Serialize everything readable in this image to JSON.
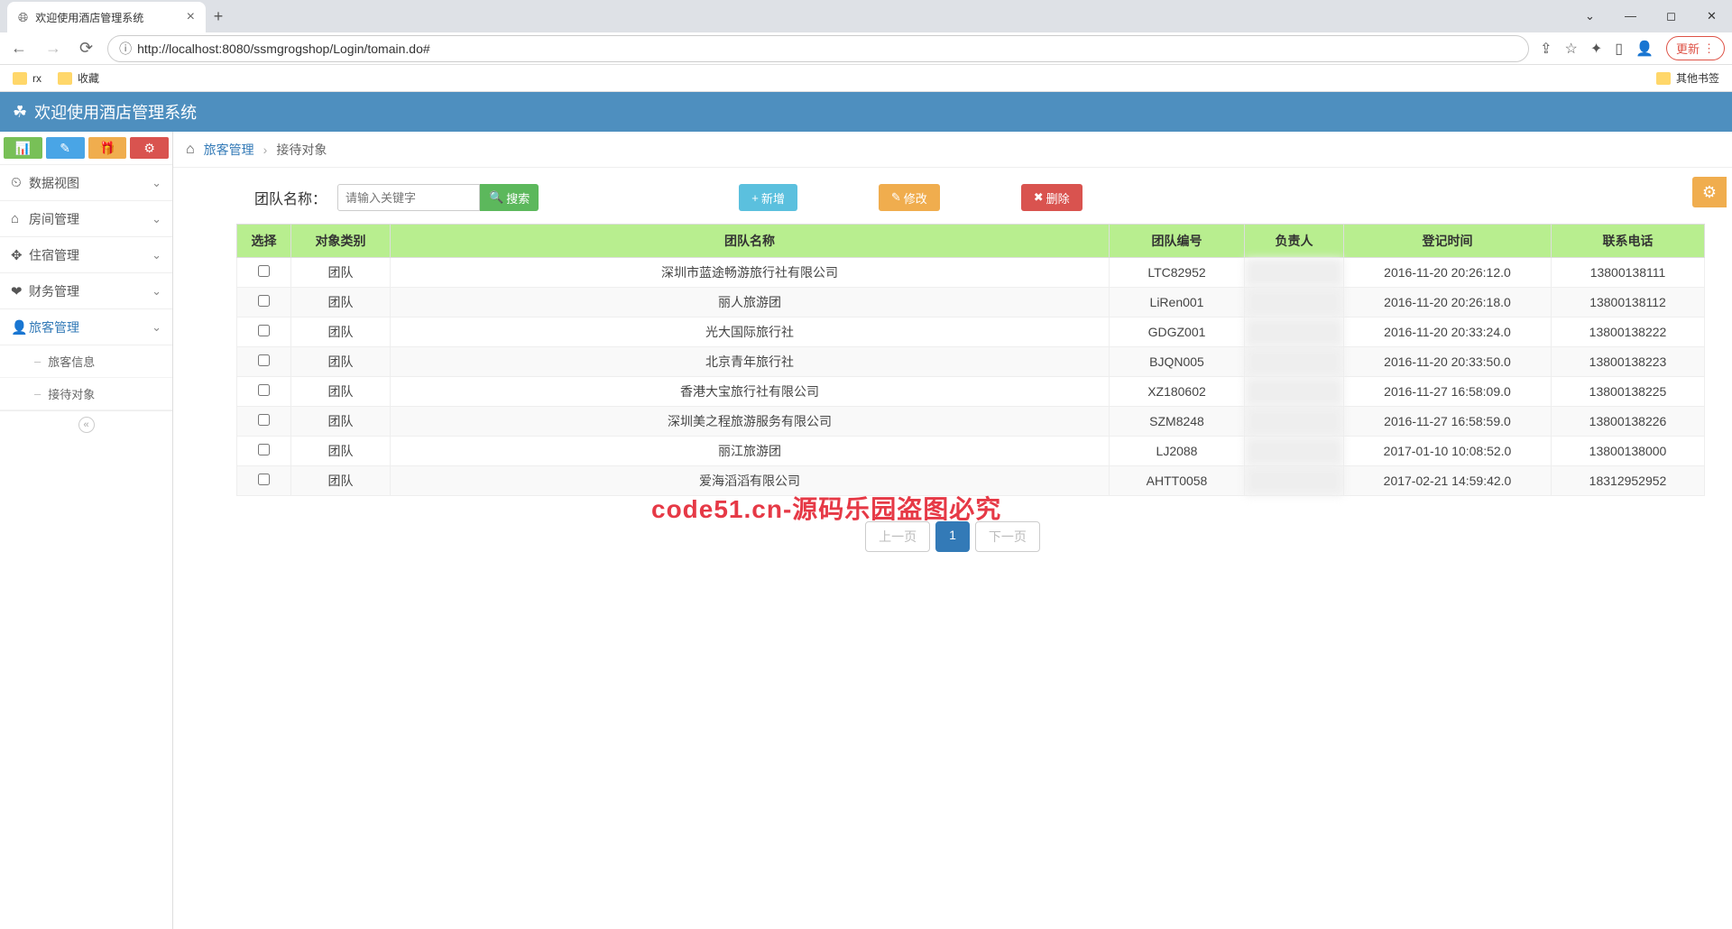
{
  "browser": {
    "tab_title": "欢迎使用酒店管理系统",
    "url": "http://localhost:8080/ssmgrogshop/Login/tomain.do#",
    "update_label": "更新",
    "bookmarks": [
      "rx",
      "收藏"
    ],
    "other_bookmarks": "其他书签"
  },
  "app": {
    "title": "欢迎使用酒店管理系统"
  },
  "sidebar": {
    "items": [
      {
        "icon": "⏲",
        "label": "数据视图"
      },
      {
        "icon": "⌂",
        "label": "房间管理"
      },
      {
        "icon": "✥",
        "label": "住宿管理"
      },
      {
        "icon": "❤",
        "label": "财务管理"
      },
      {
        "icon": "👤",
        "label": "旅客管理"
      }
    ],
    "sub_items": [
      "旅客信息",
      "接待对象"
    ]
  },
  "breadcrumb": {
    "parent": "旅客管理",
    "current": "接待对象"
  },
  "search": {
    "label": "团队名称：",
    "placeholder": "请输入关键字",
    "button": "搜索"
  },
  "actions": {
    "add": "新增",
    "edit": "修改",
    "delete": "删除"
  },
  "table": {
    "headers": [
      "选择",
      "对象类别",
      "团队名称",
      "团队编号",
      "负责人",
      "登记时间",
      "联系电话"
    ],
    "rows": [
      [
        "团队",
        "深圳市蓝途畅游旅行社有限公司",
        "LTC82952",
        "",
        "2016-11-20 20:26:12.0",
        "13800138111"
      ],
      [
        "团队",
        "丽人旅游团",
        "LiRen001",
        "",
        "2016-11-20 20:26:18.0",
        "13800138112"
      ],
      [
        "团队",
        "光大国际旅行社",
        "GDGZ001",
        "",
        "2016-11-20 20:33:24.0",
        "13800138222"
      ],
      [
        "团队",
        "北京青年旅行社",
        "BJQN005",
        "",
        "2016-11-20 20:33:50.0",
        "13800138223"
      ],
      [
        "团队",
        "香港大宝旅行社有限公司",
        "XZ180602",
        "",
        "2016-11-27 16:58:09.0",
        "13800138225"
      ],
      [
        "团队",
        "深圳美之程旅游服务有限公司",
        "SZM8248",
        "",
        "2016-11-27 16:58:59.0",
        "13800138226"
      ],
      [
        "团队",
        "丽江旅游团",
        "LJ2088",
        "",
        "2017-01-10 10:08:52.0",
        "13800138000"
      ],
      [
        "团队",
        "爱海滔滔有限公司",
        "AHTT0058",
        "",
        "2017-02-21 14:59:42.0",
        "18312952952"
      ]
    ]
  },
  "pagination": {
    "prev": "上一页",
    "page": "1",
    "next": "下一页"
  },
  "watermark": "code51.cn-源码乐园盗图必究"
}
